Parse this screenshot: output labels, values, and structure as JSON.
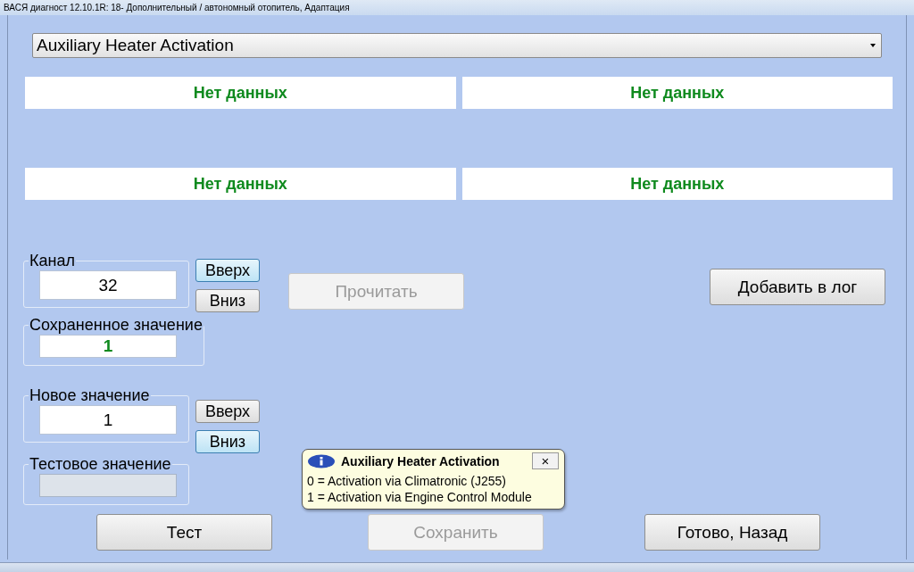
{
  "window": {
    "title": "ВАСЯ диагност 12.10.1R: 18- Дополнительный / автономный отопитель, Адаптация"
  },
  "parameter_select": {
    "value": "Auxiliary Heater Activation"
  },
  "data_fields": [
    "Нет данных",
    "Нет данных",
    "Нет данных",
    "Нет данных"
  ],
  "channel": {
    "label": "Канал",
    "value": "32",
    "up": {
      "label": "Вверх",
      "highlighted": true
    },
    "down": {
      "label": "Вниз",
      "highlighted": false
    }
  },
  "read_button": {
    "label": "Прочитать",
    "disabled": true
  },
  "log_button": {
    "label": "Добавить в лог",
    "disabled": false
  },
  "stored_value": {
    "label": "Сохраненное значение",
    "value": "1"
  },
  "new_value": {
    "label": "Новое значение",
    "value": "1",
    "up": {
      "label": "Вверх",
      "highlighted": false
    },
    "down": {
      "label": "Вниз",
      "highlighted": true
    }
  },
  "test_value": {
    "label": "Тестовое значение",
    "disabled": true
  },
  "buttons": [
    {
      "label": "Тест",
      "disabled": false
    },
    {
      "label": "Сохранить",
      "disabled": true
    },
    {
      "label": "Готово, Назад",
      "disabled": false
    }
  ],
  "tooltip": {
    "title": "Auxiliary Heater Activation",
    "close": "×",
    "lines": [
      "0 = Activation via Climatronic (J255)",
      "1 = Activation via Engine Control Module"
    ]
  }
}
